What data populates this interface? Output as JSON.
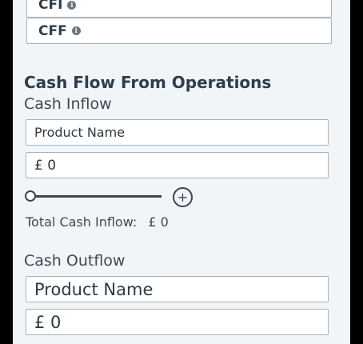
{
  "top": {
    "cfi_label": "CFI",
    "cff_label": "CFF"
  },
  "section": {
    "title": "Cash Flow From Operations"
  },
  "inflow": {
    "label": "Cash Inflow",
    "product_placeholder": "Product Name",
    "amount_value": "£ 0",
    "total_label": "Total Cash Inflow:",
    "total_value": "£ 0"
  },
  "outflow": {
    "label": "Cash Outflow",
    "product_placeholder": "Product Name",
    "amount_value": "£ 0"
  },
  "icons": {
    "info": "info-icon",
    "add": "plus-circle-icon"
  }
}
